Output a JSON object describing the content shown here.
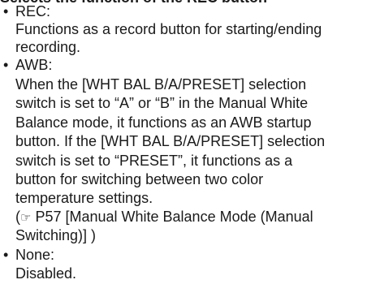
{
  "top_partial_text": "Selects the function of the REC button",
  "items": [
    {
      "term": "REC:",
      "description": [
        "Functions as a record button for starting/ending",
        "recording."
      ]
    },
    {
      "term": "AWB:",
      "description": [
        "When the [WHT BAL B/A/PRESET] selection",
        "switch is set to “A” or “B” in the Manual White",
        "Balance mode, it functions as an AWB startup",
        "button. If the [WHT BAL B/A/PRESET] selection",
        "switch is set to “PRESET”, it functions as a",
        "button for switching between two color",
        "temperature settings."
      ],
      "reference": {
        "icon": "☞",
        "line1": " P57 [Manual White Balance Mode (Manual",
        "line2": "Switching)] )",
        "open_paren": "("
      }
    },
    {
      "term": "None:",
      "description": [
        "Disabled."
      ]
    }
  ],
  "bullet_glyph": "•"
}
